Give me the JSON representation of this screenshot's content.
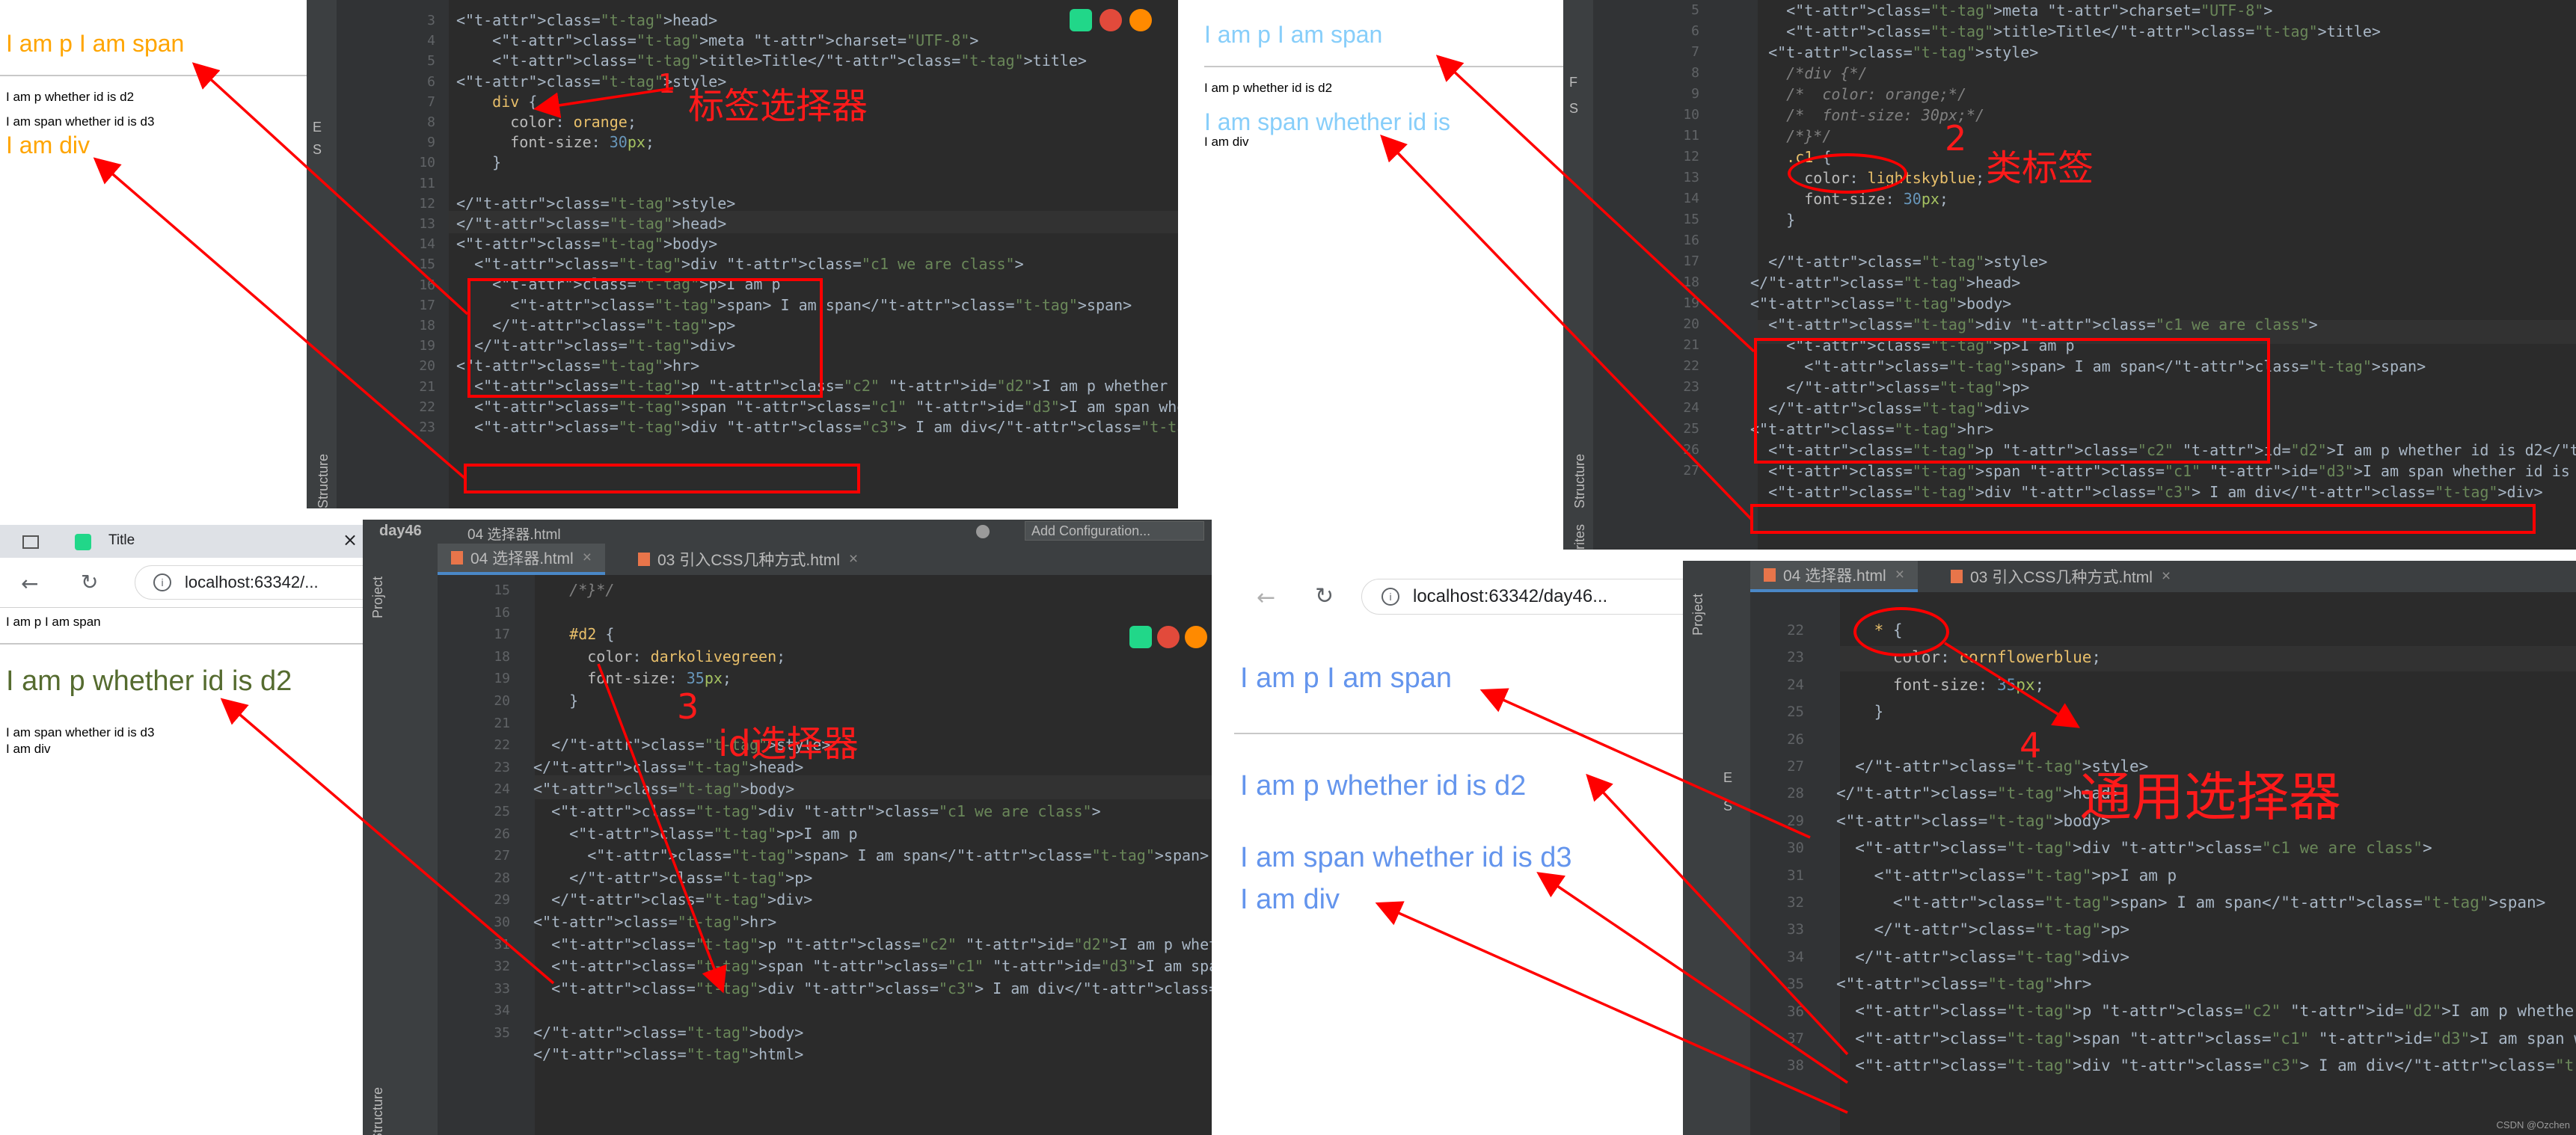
{
  "colors": {
    "orange": "#ffa500",
    "lightskyblue": "#87cefa",
    "darkolivegreen": "#556b2f",
    "cornflowerblue": "#6495ed",
    "annotation": "#ff0000"
  },
  "q1": {
    "browser": {
      "span_line": "I am p I am span",
      "p_d2": "I am p whether id is d2",
      "span_d3": "I am span whether id is d3",
      "div": "I am div"
    },
    "line_numbers": [
      "3",
      "4",
      "5",
      "6",
      "7",
      "8",
      "9",
      "10",
      "11",
      "12",
      "13",
      "14",
      "15",
      "16",
      "17",
      "18",
      "19",
      "20",
      "21",
      "22",
      "23"
    ],
    "code": [
      "<head>",
      "    <meta charset=\"UTF-8\">",
      "    <title>Title</title>",
      "<style>",
      "    div {",
      "      color: orange;",
      "      font-size: 30px;",
      "    }",
      "",
      "</style>",
      "</head>",
      "<body>",
      "  <div class=\"c1 we are class\">",
      "    <p>I am p",
      "      <span> I am span</span>",
      "    </p>",
      "  </div>",
      "<hr>",
      "  <p class=\"c2\" id=\"d2\">I am p whether id is d2</p>",
      "  <span class=\"c1\" id=\"d3\">I am span whether id is d3 </span>",
      "  <div class=\"c3\"> I am div</div>"
    ],
    "annotation_number": "1",
    "annotation_label": "标签选择器",
    "side_labels": [
      "E",
      "S",
      "Structure"
    ]
  },
  "q2": {
    "browser": {
      "span_line": "I am p I am span",
      "p_d2": "I am p whether id is d2",
      "span_d3": "I am span whether id is",
      "div": "I am div"
    },
    "line_numbers": [
      "5",
      "6",
      "7",
      "8",
      "9",
      "10",
      "11",
      "12",
      "13",
      "14",
      "15",
      "16",
      "17",
      "18",
      "19",
      "20",
      "21",
      "22",
      "23",
      "24",
      "25",
      "26",
      "27"
    ],
    "code": [
      "    <meta charset=\"UTF-8\">",
      "    <title>Title</title>",
      "  <style>",
      "    /*div {*/",
      "    /*  color: orange;*/",
      "    /*  font-size: 30px;*/",
      "    /*}*/",
      "    .c1 {",
      "      color: lightskyblue;",
      "      font-size: 30px;",
      "    }",
      "",
      "  </style>",
      "</head>",
      "<body>",
      "  <div class=\"c1 we are class\">",
      "    <p>I am p",
      "      <span> I am span</span>",
      "    </p>",
      "  </div>",
      "<hr>",
      "  <p class=\"c2\" id=\"d2\">I am p whether id is d2</p>",
      "  <span class=\"c1\" id=\"d3\">I am span whether id is d3 </span>",
      "  <div class=\"c3\"> I am div</div>"
    ],
    "annotation_number": "2",
    "annotation_label": "类标签",
    "side_labels": [
      "F",
      "S",
      "Structure",
      "rites"
    ]
  },
  "q3": {
    "tab_title": "Title",
    "close_glyph": "×",
    "address": "localhost:63342/...",
    "project": "day46",
    "file_path": "04 选择器.html",
    "tabs": [
      "04 选择器.html",
      "03 引入CSS几种方式.html"
    ],
    "add_config": "Add Configuration...",
    "browser": {
      "span_line": "I am p I am span",
      "p_d2": "I am p whether id is d2",
      "span_d3": "I am span whether id is d3",
      "div": "I am div"
    },
    "line_numbers": [
      "15",
      "16",
      "17",
      "18",
      "19",
      "20",
      "21",
      "22",
      "23",
      "24",
      "25",
      "26",
      "27",
      "28",
      "29",
      "30",
      "31",
      "32",
      "33",
      "34",
      "35"
    ],
    "code": [
      "    /*}*/",
      "",
      "    #d2 {",
      "      color: darkolivegreen;",
      "      font-size: 35px;",
      "    }",
      "",
      "  </style>",
      "</head>",
      "<body>",
      "  <div class=\"c1 we are class\">",
      "    <p>I am p",
      "      <span> I am span</span>",
      "    </p>",
      "  </div>",
      "<hr>",
      "  <p class=\"c2\" id=\"d2\">I am p whether id is d2</p>",
      "  <span class=\"c1\" id=\"d3\">I am span whether id is d3 </span>",
      "  <div class=\"c3\"> I am div</div>",
      "",
      "</body>",
      "</html>"
    ],
    "annotation_number": "3",
    "annotation_label": "id选择器",
    "side_labels": [
      "Project",
      "E",
      "S",
      "Structure"
    ]
  },
  "q4": {
    "address": "localhost:63342/day46...",
    "tabs": [
      "04 选择器.html",
      "03 引入CSS几种方式.html"
    ],
    "browser": {
      "span_line": "I am p I am span",
      "p_d2": "I am p whether id is d2",
      "span_d3": "I am span whether id is d3",
      "div": "I am div"
    },
    "line_numbers": [
      "22",
      "23",
      "24",
      "25",
      "26",
      "27",
      "28",
      "29",
      "30",
      "31",
      "32",
      "33",
      "34",
      "35",
      "36",
      "37",
      "38"
    ],
    "code": [
      "    * {",
      "      color: cornflowerblue;",
      "      font-size: 35px;",
      "    }",
      "",
      "  </style>",
      "</head>",
      "<body>",
      "  <div class=\"c1 we are class\">",
      "    <p>I am p",
      "      <span> I am span</span>",
      "    </p>",
      "  </div>",
      "<hr>",
      "  <p class=\"c2\" id=\"d2\">I am p whether id is d2</p>",
      "  <span class=\"c1\" id=\"d3\">I am span whether id is d3 </span>",
      "  <div class=\"c3\"> I am div</div>"
    ],
    "annotation_number": "4",
    "annotation_label": "通用选择器",
    "side_labels": [
      "Project",
      "E",
      "S"
    ]
  },
  "watermark": "CSDN @Ozchen"
}
